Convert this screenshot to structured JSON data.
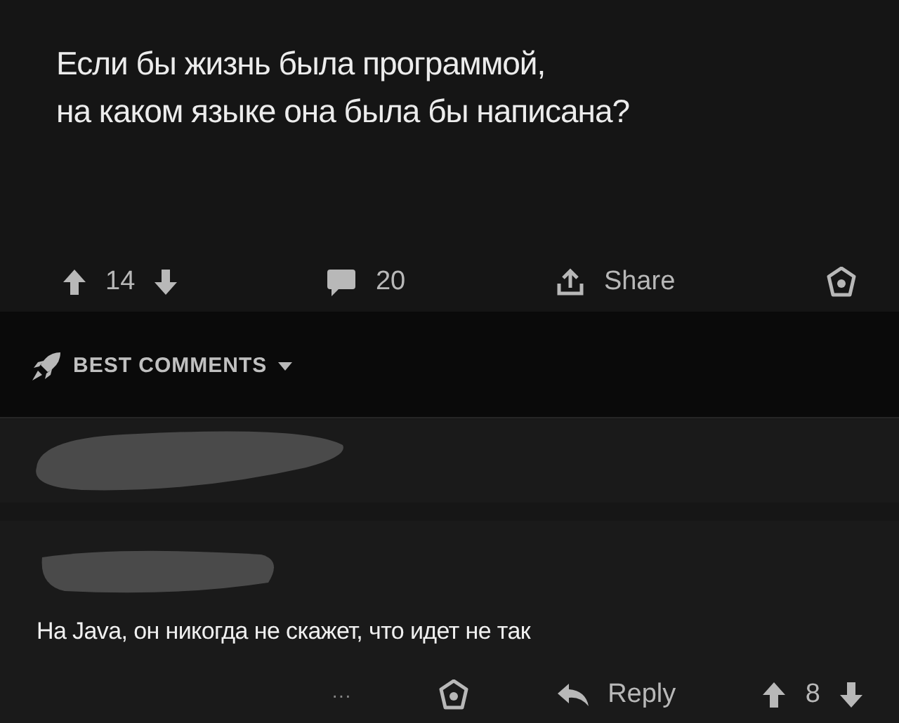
{
  "post": {
    "title_lines": [
      "Если бы жизнь была программой,",
      "на каком языке она была бы написана?"
    ],
    "votes": "14",
    "comments": "20",
    "share": "Share"
  },
  "sort": {
    "label": "BEST COMMENTS"
  },
  "comments": [
    {
      "kind": "collapsed"
    },
    {
      "kind": "full",
      "body": "На Java, он никогда не скажет, что идет не так",
      "more": "···",
      "reply": "Reply",
      "votes": "8"
    }
  ]
}
